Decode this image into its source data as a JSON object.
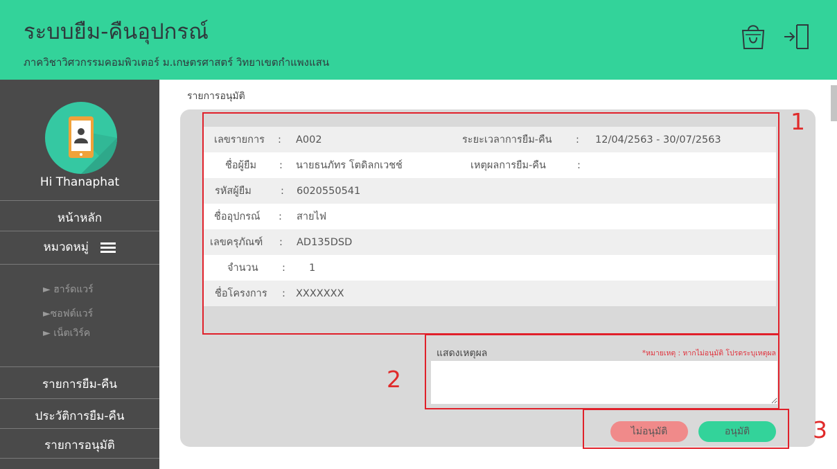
{
  "app": {
    "title": "ระบบยืม-คืนอุปกรณ์",
    "subtitle": "ภาควิชาวิศวกรรมคอมพิวเตอร์ ม.เกษตรศาสตร์ วิทยาเขตกำแพงแสน"
  },
  "header_icons": [
    "shopping-bag-icon",
    "logout-icon"
  ],
  "sidebar": {
    "greeting": "Hi Thanaphat",
    "home": "หน้าหลัก",
    "category": "หมวดหมู่",
    "sub_items": [
      "► ฮาร์ดแวร์",
      "►ซอฟต์แวร์",
      "► เน็ตเวิร์ค"
    ],
    "borrow_list": "รายการยืม-คืน",
    "history": "ประวัติการยืม-คืน",
    "approval": "รายการอนุมัติ"
  },
  "content": {
    "section_title": "รายการอนุมัติ",
    "details": {
      "item_no_label": "เลขรายการ",
      "item_no": "A002",
      "period_label": "ระยะเวลาการยืม-คืน",
      "period": "12/04/2563 - 30/07/2563",
      "borrower_label": "ชื่อผู้ยืม",
      "borrower": "นายธนภัทร โตดิลกเวชช์",
      "reason_label": "เหตุผลการยืม-คืน",
      "reason": "",
      "borrower_id_label": "รหัสผู้ยืม",
      "borrower_id": "6020550541",
      "equipment_label": "ชื่ออุปกรณ์",
      "equipment": "สายไฟ",
      "asset_no_label": "เลขครุภัณฑ์",
      "asset_no": "AD135DSD",
      "quantity_label": "จำนวน",
      "quantity": "1",
      "project_label": "ชื่อโครงการ",
      "project": "XXXXXXX",
      "colon": ":"
    },
    "reason_box": {
      "title": "แสดงเหตุผล",
      "note": "*หมายเหตุ : หากไม่อนุมัติ โปรดระบุเหตุผล",
      "value": ""
    },
    "buttons": {
      "reject": "ไม่อนุมัติ",
      "approve": "อนุมัติ"
    },
    "annotations": [
      "1",
      "2",
      "3"
    ]
  },
  "colors": {
    "header": "#33d39a",
    "sidebar": "#4a4a4a",
    "reject_button": "#f08a8a",
    "approve_button": "#33d39a",
    "annotation": "#e0202a"
  }
}
